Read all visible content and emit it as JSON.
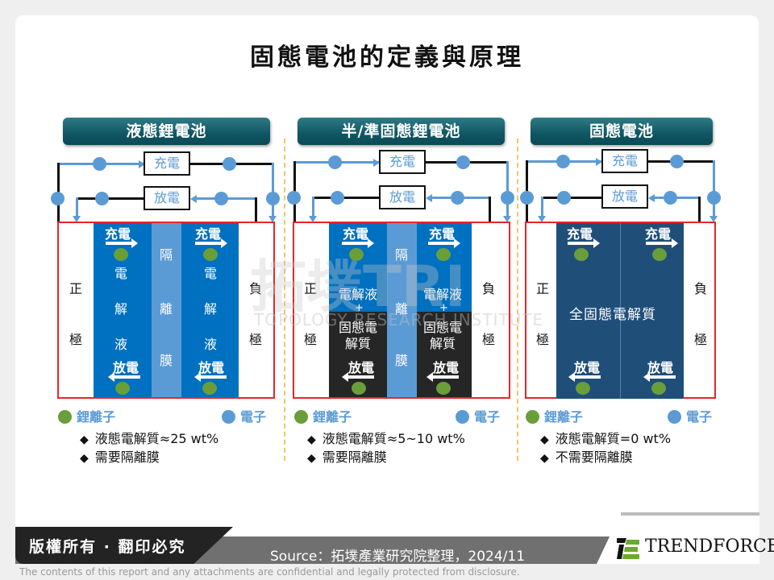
{
  "title": "固態電池的定義與原理",
  "common": {
    "charge": "充電",
    "discharge": "放電",
    "positive": [
      "正",
      "極"
    ],
    "negative": [
      "負",
      "極"
    ],
    "legend_ion": "鋰離子",
    "legend_electron": "電子",
    "separator": [
      "隔",
      "離",
      "膜"
    ]
  },
  "panels": [
    {
      "header": "液態鋰電池",
      "electrolyte": [
        "電",
        "解",
        "液"
      ],
      "bullets": [
        "液態電解質≈25 wt%",
        "需要隔離膜"
      ]
    },
    {
      "header": "半/準固態鋰電池",
      "electrolyte_top": "電解液",
      "plus": "+",
      "electrolyte_bottom": [
        "固態電",
        "解質"
      ],
      "bullets": [
        "液態電解質≈5~10 wt%",
        "需要隔離膜"
      ]
    },
    {
      "header": "固態電池",
      "electrolyte": "全固態電解質",
      "bullets": [
        "液態電解質=0 wt%",
        "不需要隔離膜"
      ]
    }
  ],
  "watermark": {
    "main": "拓墣TRI",
    "sub": "TOPOLOGY RESEARCH INSTITUTE"
  },
  "footer": {
    "copyright": "版權所有 · 翻印必究",
    "source": "Source：拓墣產業研究院整理，2024/11",
    "logo": "TRENDFORCE",
    "disclaimer": "The contents of this report and any attachments are confidential and legally protected from disclosure."
  },
  "colors": {
    "header_bg": "#0f5663",
    "electron": "#5b9bd5",
    "ion": "#6a9e3a",
    "liquid_electrolyte": "#0070c0",
    "separator": "#5b9bd5",
    "solid_mix": "#262626",
    "solid_electrolyte": "#1f4e79",
    "cell_border": "#e8252b",
    "divider": "#f2c46b"
  }
}
